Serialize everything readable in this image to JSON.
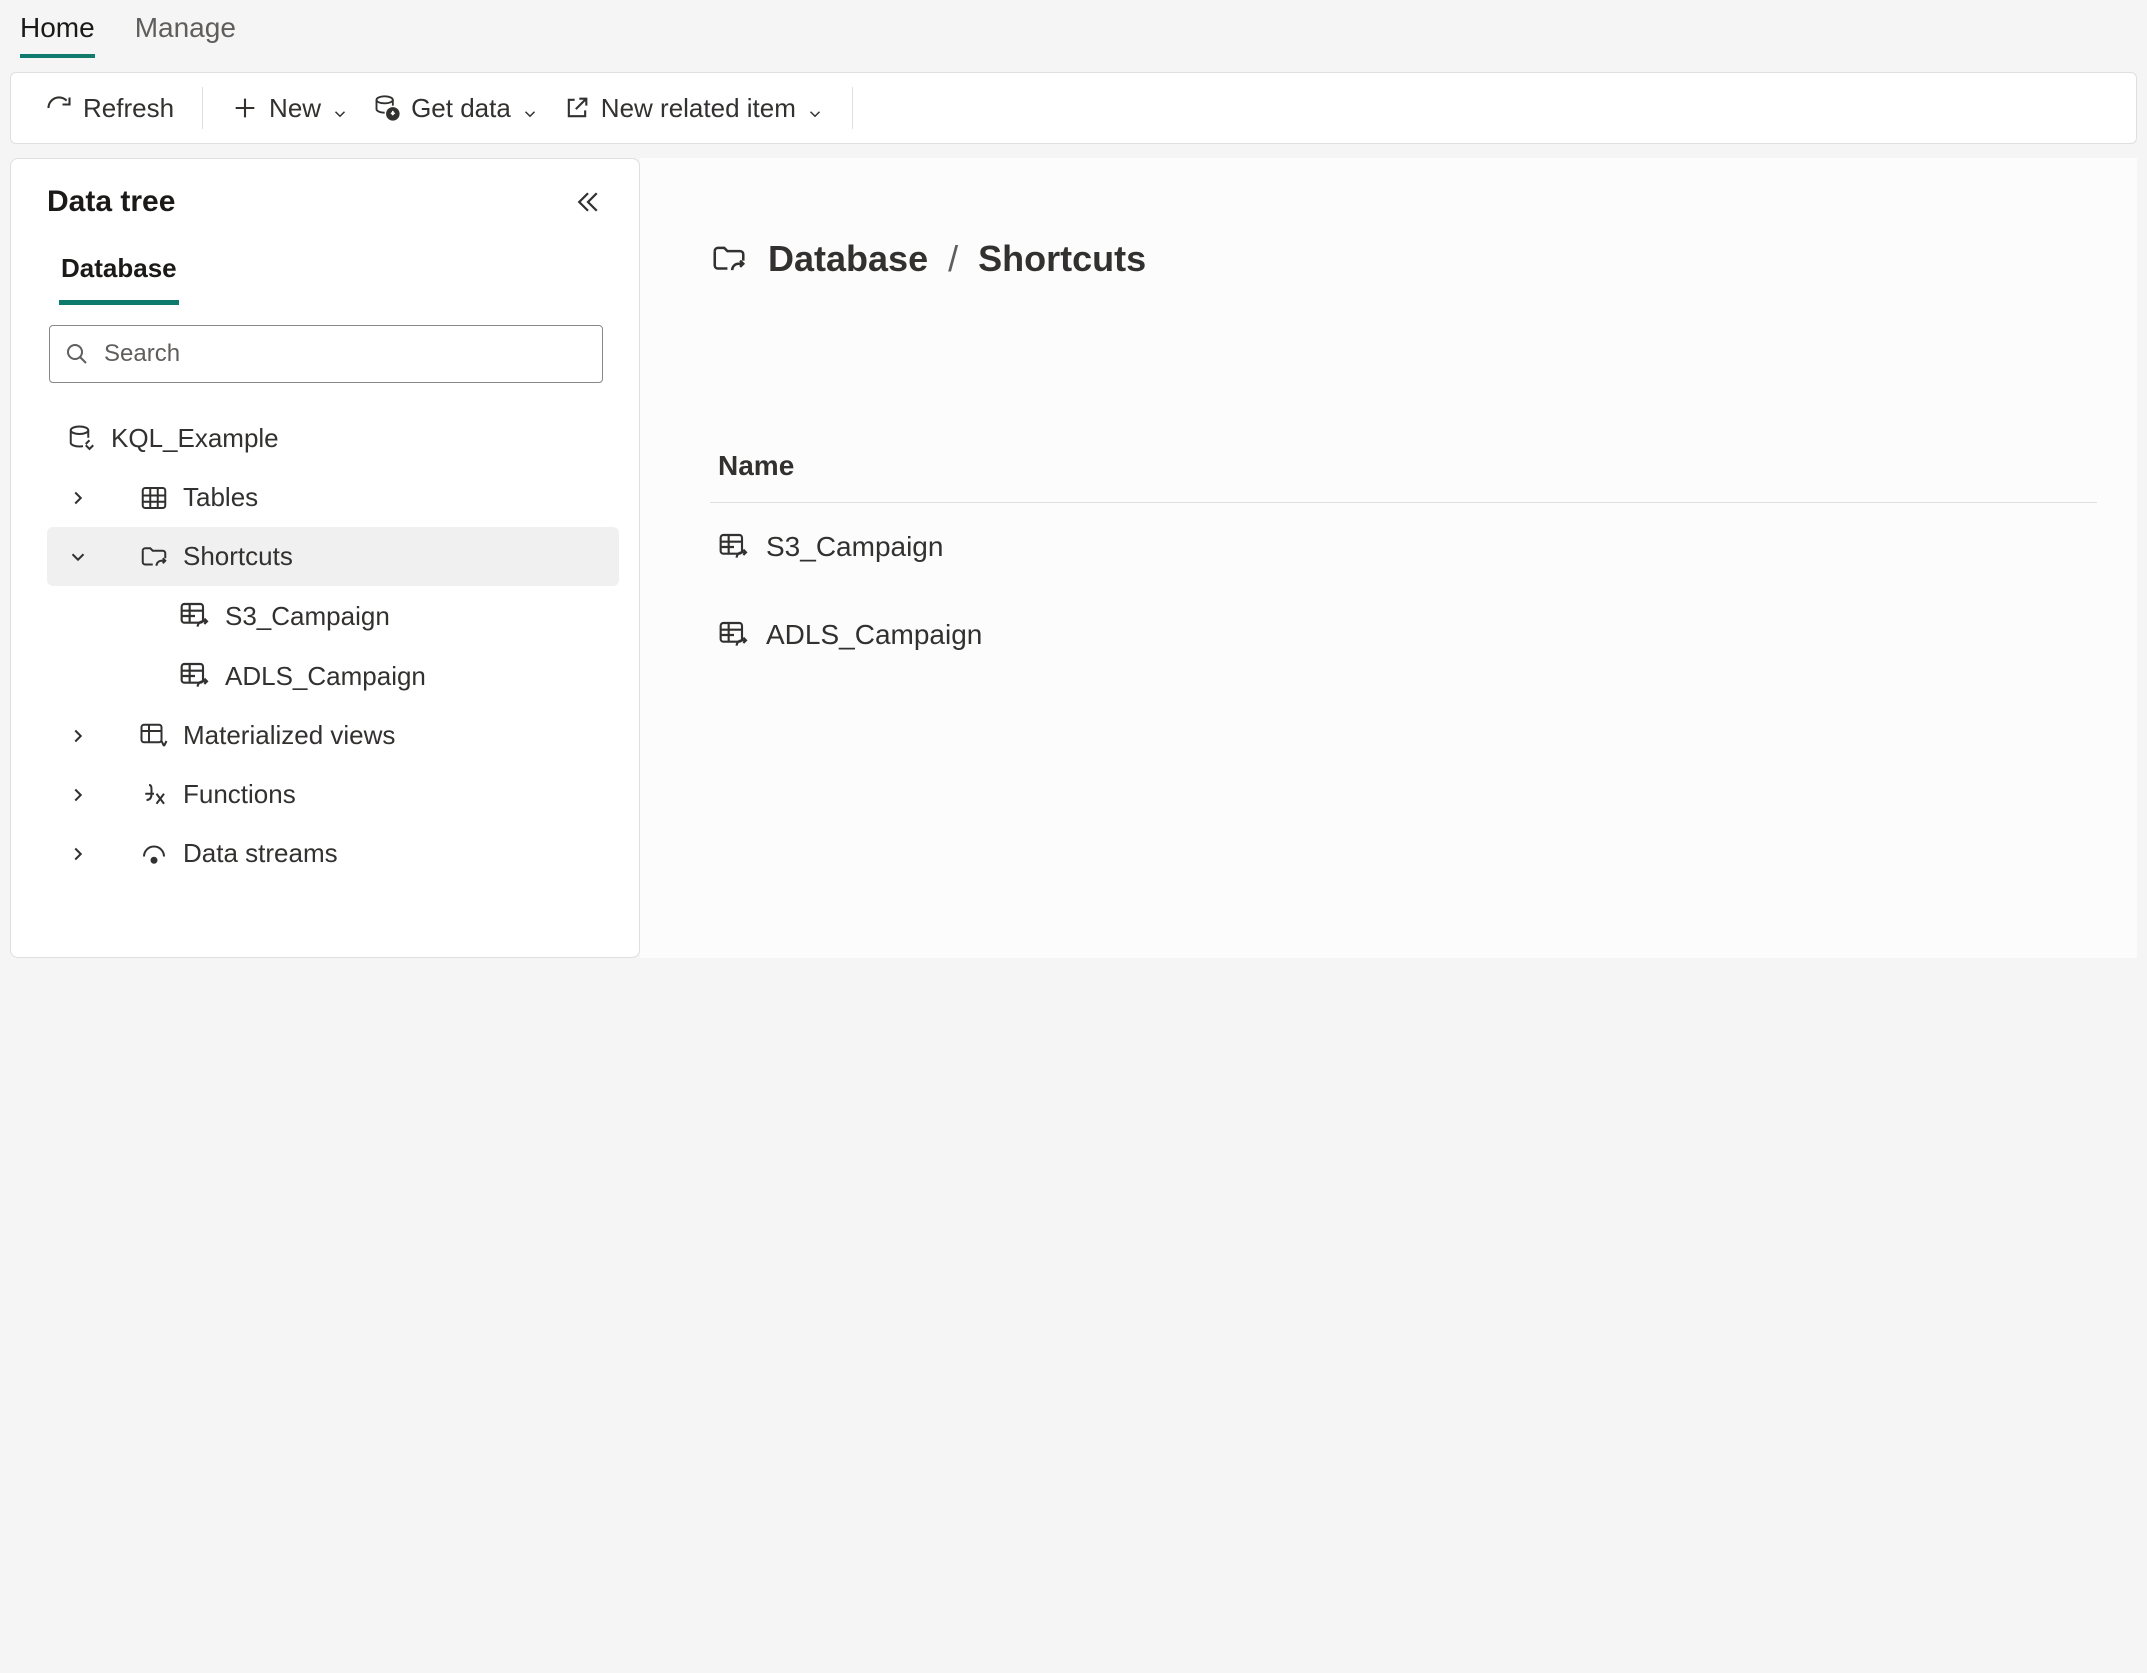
{
  "top_tabs": {
    "home": "Home",
    "manage": "Manage"
  },
  "toolbar": {
    "refresh": "Refresh",
    "new": "New",
    "get_data": "Get data",
    "new_related": "New related item"
  },
  "sidebar": {
    "title": "Data tree",
    "sub_tab": "Database",
    "search_placeholder": "Search",
    "tree": {
      "root": "KQL_Example",
      "tables": "Tables",
      "shortcuts": "Shortcuts",
      "shortcuts_children": [
        "S3_Campaign",
        "ADLS_Campaign"
      ],
      "materialized_views": "Materialized views",
      "functions": "Functions",
      "data_streams": "Data streams"
    }
  },
  "content": {
    "breadcrumb": {
      "database": "Database",
      "shortcuts": "Shortcuts"
    },
    "table": {
      "header_name": "Name",
      "rows": [
        "S3_Campaign",
        "ADLS_Campaign"
      ]
    }
  }
}
